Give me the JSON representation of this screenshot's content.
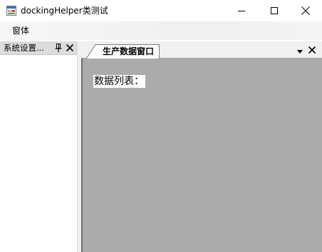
{
  "window": {
    "title": "dockingHelper类测试",
    "app_icon": "windows-form-icon",
    "controls": {
      "minimize_icon": "minimize-icon",
      "maximize_icon": "maximize-icon",
      "close_icon": "close-icon"
    }
  },
  "menubar": {
    "items": [
      {
        "label": "窗体"
      }
    ]
  },
  "left_panel": {
    "title": "系统设置...",
    "pin_icon": "pin-icon",
    "close_icon": "close-icon"
  },
  "document": {
    "tabs": [
      {
        "label": "生产数据窗口",
        "active": true
      }
    ],
    "dropdown_icon": "dropdown-arrow-icon",
    "close_icon": "close-icon",
    "content": {
      "label": "数据列表："
    }
  },
  "colors": {
    "content_background": "#ababab",
    "panel_header": "#dcdcdc",
    "chrome": "#f0f0f0"
  }
}
